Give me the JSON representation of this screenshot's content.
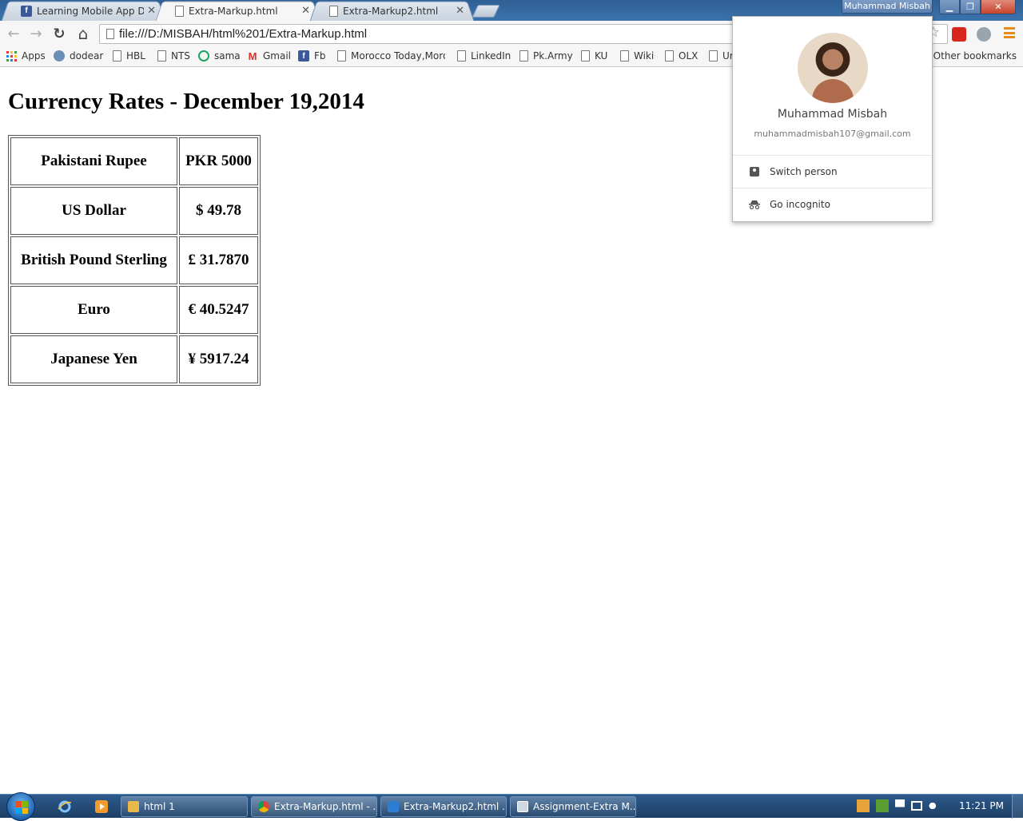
{
  "window": {
    "profile_button": "Muhammad Misbah",
    "min_glyph": "▁",
    "max_glyph": "❐",
    "close_glyph": "✕"
  },
  "tabs": [
    {
      "label": "Learning Mobile App Deve",
      "icon": "facebook-icon",
      "active": false
    },
    {
      "label": "Extra-Markup.html",
      "icon": "page-icon",
      "active": true
    },
    {
      "label": "Extra-Markup2.html",
      "icon": "page-icon",
      "active": false
    }
  ],
  "tab_close_glyph": "✕",
  "toolbar": {
    "back_glyph": "←",
    "forward_glyph": "→",
    "reload_glyph": "↻",
    "home_glyph": "⌂",
    "url": "file:///D:/MISBAH/html%201/Extra-Markup.html",
    "star_glyph": "☆"
  },
  "bookmarks": [
    {
      "label": "Apps",
      "icon": "apps-grid-icon"
    },
    {
      "label": "dodear",
      "icon": "dodear-icon"
    },
    {
      "label": "HBL",
      "icon": "page-icon"
    },
    {
      "label": "NTS",
      "icon": "page-icon"
    },
    {
      "label": "sama",
      "icon": "sama-icon"
    },
    {
      "label": "Gmail",
      "icon": "gmail-icon"
    },
    {
      "label": "Fb",
      "icon": "facebook-icon"
    },
    {
      "label": "Morocco Today,Moro",
      "icon": "page-icon"
    },
    {
      "label": "LinkedIn",
      "icon": "page-icon"
    },
    {
      "label": "Pk.Army",
      "icon": "page-icon"
    },
    {
      "label": "KU",
      "icon": "page-icon"
    },
    {
      "label": "Wiki",
      "icon": "page-icon"
    },
    {
      "label": "OLX",
      "icon": "page-icon"
    },
    {
      "label": "Ur",
      "icon": "page-icon"
    }
  ],
  "other_bookmarks": "Other bookmarks",
  "page": {
    "title": "Currency Rates - December 19,2014",
    "rates": [
      {
        "currency": "Pakistani Rupee",
        "value": "PKR 5000"
      },
      {
        "currency": "US Dollar",
        "value": "$ 49.78"
      },
      {
        "currency": "British Pound Sterling",
        "value": "£ 31.7870"
      },
      {
        "currency": "Euro",
        "value": "€ 40.5247"
      },
      {
        "currency": "Japanese Yen",
        "value": "¥ 5917.24"
      }
    ]
  },
  "profile_popup": {
    "name": "Muhammad Misbah",
    "email": "muhammadmisbah107@gmail.com",
    "switch_person": "Switch person",
    "go_incognito": "Go incognito"
  },
  "taskbar": {
    "tasks": [
      {
        "label": "html 1",
        "icon": "folder-icon"
      },
      {
        "label": "Extra-Markup.html - ...",
        "icon": "chrome-icon"
      },
      {
        "label": "Extra-Markup2.html ...",
        "icon": "visual-studio-icon"
      },
      {
        "label": "Assignment-Extra M...",
        "icon": "window-icon"
      }
    ],
    "clock": "11:21 PM"
  },
  "colors": {
    "titlebar": "#3c73ad",
    "taskbar": "#1d3f66",
    "menu_accent": "#e68d1c"
  }
}
